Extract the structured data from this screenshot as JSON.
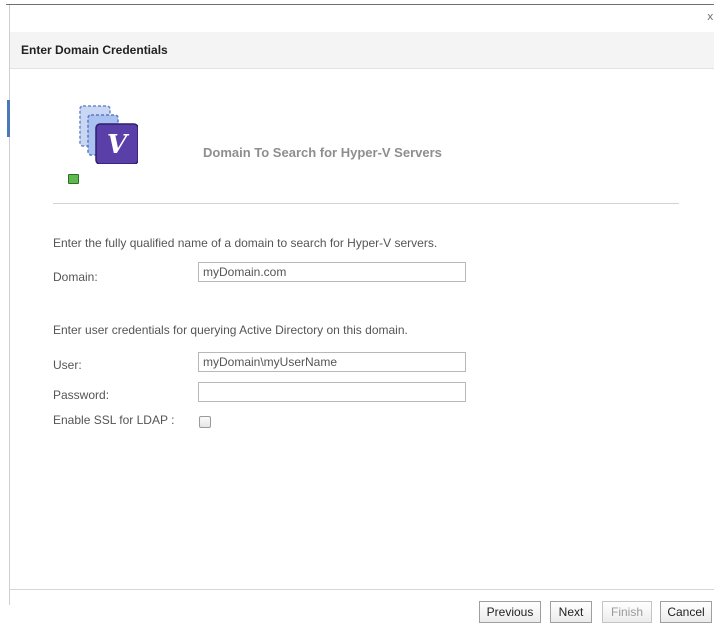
{
  "window": {
    "close_glyph": "x"
  },
  "header": {
    "title": "Enter Domain Credentials"
  },
  "section": {
    "icon": "hyper-v-server-icon",
    "heading": "Domain To Search for Hyper-V Servers"
  },
  "form": {
    "domain_intro": "Enter the fully qualified name of a domain to search for Hyper-V servers.",
    "domain_label": "Domain:",
    "domain_value": "myDomain.com",
    "credentials_intro": "Enter user credentials for querying Active Directory on this domain.",
    "user_label": "User:",
    "user_value": "myDomain\\myUserName",
    "password_label": "Password:",
    "password_value": "",
    "ssl_label": "Enable SSL for LDAP :",
    "ssl_checked": false
  },
  "footer": {
    "previous": "Previous",
    "next": "Next",
    "finish": "Finish",
    "cancel": "Cancel"
  },
  "colors": {
    "accent": "#4a78b8",
    "icon_purple": "#5b3fa8",
    "status_green": "#5db84d"
  }
}
